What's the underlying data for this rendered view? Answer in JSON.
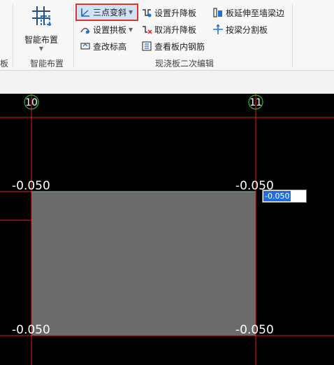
{
  "ribbon": {
    "left_partial_label": "板",
    "smart_layout": {
      "button_label": "智能布置",
      "group_label": "智能布置"
    },
    "edit_group": {
      "group_label": "现浇板二次编辑",
      "three_point_slope": "三点变斜",
      "set_arch_slab": "设置拱板",
      "check_elevation": "查改标高",
      "set_raise_lower_slab": "设置升降板",
      "cancel_raise_lower_slab": "取消升降板",
      "view_slab_rebar": "查看板内钢筋",
      "extend_slab_to_wall_beam": "板延伸至墙梁边",
      "split_slab_by_beam": "按梁分割板"
    }
  },
  "canvas": {
    "axes": [
      {
        "label": "10"
      },
      {
        "label": "11"
      }
    ],
    "elevations": {
      "top_left": "-0.050",
      "top_right": "-0.050",
      "bottom_left": "-0.050",
      "bottom_right": "-0.050"
    },
    "input_value": "-0.050"
  },
  "colors": {
    "canvas_bg": "#000000",
    "grid_line": "#e02020",
    "axis_circle": "#2fb82f",
    "slab_fill": "#6b6b6b",
    "selected_border": "#e0342b"
  }
}
